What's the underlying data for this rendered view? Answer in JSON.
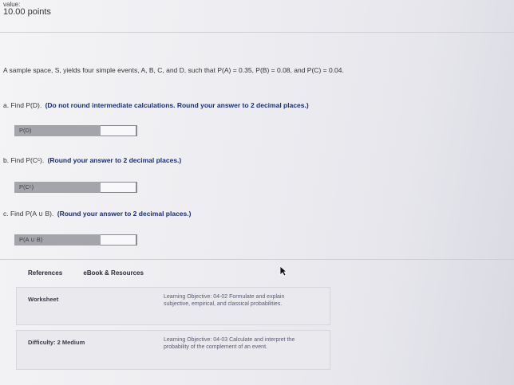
{
  "header": {
    "value_label": "value:",
    "points": "10.00 points"
  },
  "question": {
    "text": "A sample space, S, yields four simple events, A, B, C, and D, such that P(A) = 0.35, P(B) = 0.08, and P(C) = 0.04."
  },
  "parts": [
    {
      "prefix": "a.  Find P(D).",
      "hint": "(Do not round intermediate calculations. Round your answer to 2 decimal places.)",
      "answer_label": "P(D)",
      "value": ""
    },
    {
      "prefix": "b.  Find P(Cᶜ).",
      "hint": "(Round your answer to 2 decimal places.)",
      "answer_label": "P(Cᶜ)",
      "value": ""
    },
    {
      "prefix": "c.  Find P(A ∪ B).",
      "hint": "(Round your answer to 2 decimal places.)",
      "answer_label": "P(A ∪ B)",
      "value": ""
    }
  ],
  "tabs": {
    "references": "References",
    "ebook": "eBook & Resources"
  },
  "info": {
    "worksheet": {
      "label": "Worksheet",
      "text": "Learning Objective: 04-02 Formulate and explain subjective, empirical, and classical probabilities."
    },
    "difficulty": {
      "label": "Difficulty: 2 Medium",
      "text": "Learning Objective: 04-03 Calculate and interpret the probability of the complement of an event."
    }
  }
}
